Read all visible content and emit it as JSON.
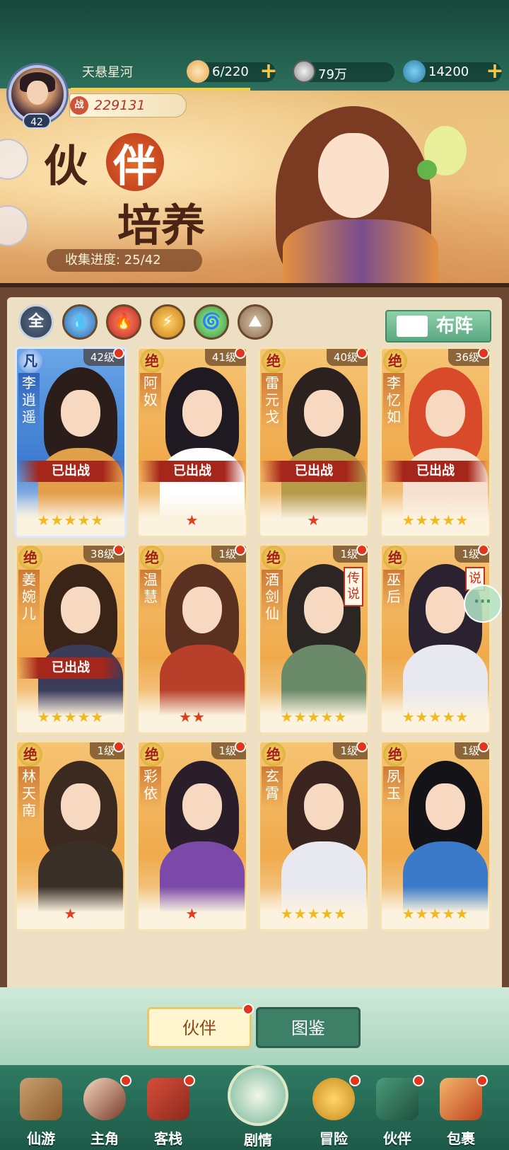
{
  "header": {
    "player_name": "天悬星河",
    "player_level": "42",
    "power_icon": "战",
    "power": "229131",
    "xp_fraction": 0.41,
    "resources": [
      {
        "icon": "bun-icon",
        "value": "6/220"
      },
      {
        "icon": "coin-icon",
        "value": "79万"
      },
      {
        "icon": "jade-icon",
        "value": "14200"
      }
    ],
    "plus": "+"
  },
  "banner": {
    "title_line1": "伙",
    "title_highlight": "伴",
    "title_line2": "培养",
    "progress_label": "收集进度: 25/42"
  },
  "filters": [
    "全",
    "水",
    "火",
    "雷",
    "风",
    "土"
  ],
  "formation_label": "布阵",
  "deployed_label": "已出战",
  "cards": [
    {
      "name": "李逍遥",
      "rarity": "凡",
      "level": "42级",
      "stars": "★★★★★",
      "deployed": true,
      "blue": true
    },
    {
      "name": "阿奴",
      "rarity": "绝",
      "level": "41级",
      "stars": "★",
      "deployed": true
    },
    {
      "name": "雷元戈",
      "rarity": "绝",
      "level": "40级",
      "stars": "★",
      "deployed": true
    },
    {
      "name": "李忆如",
      "rarity": "绝",
      "level": "36级",
      "stars": "★★★★★",
      "deployed": true
    },
    {
      "name": "姜婉儿",
      "rarity": "绝",
      "level": "38级",
      "stars": "★★★★★",
      "deployed": true
    },
    {
      "name": "温慧",
      "rarity": "绝",
      "level": "1级",
      "stars": "★★"
    },
    {
      "name": "酒剑仙",
      "rarity": "绝",
      "level": "1级",
      "stars": "★★★★★",
      "legend": "传说"
    },
    {
      "name": "巫后",
      "rarity": "绝",
      "level": "1级",
      "stars": "★★★★★",
      "legend": "说"
    },
    {
      "name": "林天南",
      "rarity": "绝",
      "level": "1级",
      "stars": "★"
    },
    {
      "name": "彩依",
      "rarity": "绝",
      "level": "1级",
      "stars": "★"
    },
    {
      "name": "玄霄",
      "rarity": "绝",
      "level": "1级",
      "stars": "★★★★★"
    },
    {
      "name": "夙玉",
      "rarity": "绝",
      "level": "1级",
      "stars": "★★★★★"
    }
  ],
  "subtabs": [
    "伙伴",
    "图鉴"
  ],
  "nav": [
    "仙游",
    "主角",
    "客栈",
    "剧情",
    "冒险",
    "伙伴",
    "包裹"
  ],
  "colors": {
    "accent": "#2f7b63",
    "gold": "#f0aa4c",
    "deployed": "#a5261a"
  }
}
